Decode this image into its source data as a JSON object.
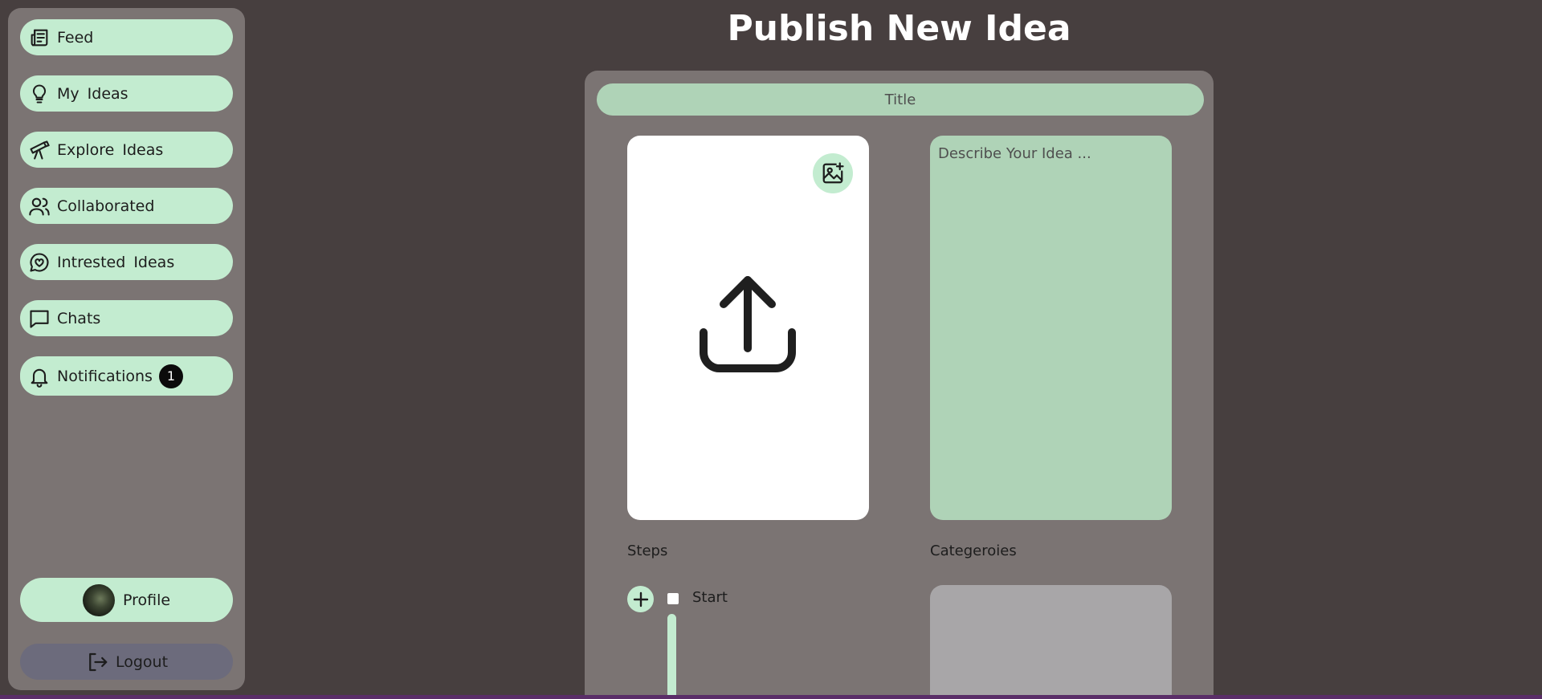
{
  "sidebar": {
    "items": [
      {
        "label": "Feed",
        "icon": "newspaper-icon"
      },
      {
        "label": "My Ideas",
        "icon": "lightbulb-icon"
      },
      {
        "label": "Explore Ideas",
        "icon": "telescope-icon"
      },
      {
        "label": "Collaborated",
        "icon": "users-icon"
      },
      {
        "label": "Intrested Ideas",
        "icon": "heart-message-icon"
      },
      {
        "label": "Chats",
        "icon": "chat-icon"
      },
      {
        "label": "Notifications",
        "icon": "bell-icon",
        "badge": "1"
      }
    ],
    "profile_label": "Profile",
    "logout_label": "Logout"
  },
  "main": {
    "title": "Publish New Idea",
    "title_placeholder": "Title",
    "description_placeholder": "Describe Your Idea ...",
    "steps_label": "Steps",
    "first_step": "Start",
    "categories_label": "Categeroies"
  },
  "colors": {
    "page_background": "#473f3f",
    "panel": "#7b7473",
    "accent_green": "#c3ecd0",
    "field_green": "#afd3b7",
    "logout": "#6c6b7c"
  }
}
